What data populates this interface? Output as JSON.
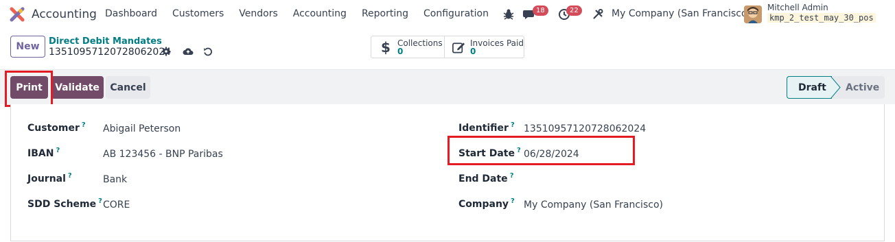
{
  "navbar": {
    "app_name": "Accounting",
    "menu": [
      "Dashboard",
      "Customers",
      "Vendors",
      "Accounting",
      "Reporting",
      "Configuration"
    ],
    "chat_badge": "18",
    "activity_badge": "22",
    "company": "My Company (San Francisco)",
    "user_name": "Mitchell Admin",
    "db_name": "kmp_2_test_may_30_pos"
  },
  "control": {
    "new_label": "New",
    "breadcrumb_parent": "Direct Debit Mandates",
    "breadcrumb_current": "13510957120728062024"
  },
  "smart_buttons": [
    {
      "label": "Collections",
      "value": "0",
      "icon": "dollar-icon"
    },
    {
      "label": "Invoices Paid",
      "value": "0",
      "icon": "edit-icon"
    }
  ],
  "actions": {
    "print": "Print",
    "validate": "Validate",
    "cancel": "Cancel"
  },
  "stages": {
    "draft": "Draft",
    "active": "Active",
    "current": "Draft"
  },
  "form": {
    "left": [
      {
        "label": "Customer",
        "value": "Abigail Peterson"
      },
      {
        "label": "IBAN",
        "value": "AB 123456 - BNP Paribas"
      },
      {
        "label": "Journal",
        "value": "Bank"
      },
      {
        "label": "SDD Scheme",
        "value": "CORE"
      }
    ],
    "right": [
      {
        "label": "Identifier",
        "value": "13510957120728062024"
      },
      {
        "label": "Start Date",
        "value": "06/28/2024"
      },
      {
        "label": "End Date",
        "value": ""
      },
      {
        "label": "Company",
        "value": "My Company (San Francisco)"
      }
    ],
    "help_mark": "?"
  },
  "colors": {
    "brand": "#714b67",
    "link": "#017e84",
    "highlight": "#e51b24",
    "badge": "#d44c59"
  }
}
